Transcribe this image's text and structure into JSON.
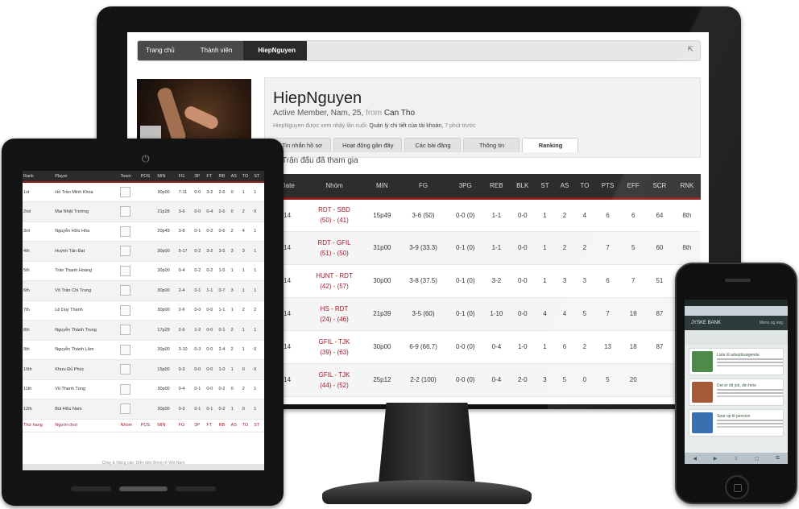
{
  "desktop": {
    "breadcrumb": [
      "Trang chủ",
      "Thành viên",
      "HiepNguyen"
    ],
    "profile": {
      "name": "HiepNguyen",
      "meta_prefix": "Active Member, Nam, 25,",
      "meta_from": "from",
      "location": "Can Tho",
      "desc_prefix": "HiepNguyen được xem nhậy lần cuối:",
      "desc_bold": "Quản lý chi tiết của tài khoản,",
      "desc_suffix": "7 phút trước",
      "tabs": [
        "Tin nhắn hồ sơ",
        "Hoạt động gần đây",
        "Các bài đăng",
        "Thông tin",
        "Ranking"
      ],
      "active_tab": "Ranking"
    },
    "section_title": "Trận đấu đã tham gia",
    "stats": {
      "columns": [
        "Date",
        "Nhóm",
        "MIN",
        "FG",
        "3PG",
        "REB",
        "BLK",
        "ST",
        "AS",
        "TO",
        "PTS",
        "EFF",
        "SCR",
        "RNK"
      ],
      "rows": [
        {
          "date": "02/14",
          "team": "RDT - SBD",
          "score": "(50) - (41)",
          "min": "15p49",
          "fg": "3-6 (50)",
          "p3": "0-0 (0)",
          "reb": "1-1",
          "blk": "0-0",
          "st": "1",
          "as": "2",
          "to": "4",
          "pts": "6",
          "eff": "6",
          "scr": "64",
          "rnk": "8th"
        },
        {
          "date": "02/14",
          "team": "RDT - GFIL",
          "score": "(51) - (50)",
          "min": "31p00",
          "fg": "3-9 (33.3)",
          "p3": "0-1 (0)",
          "reb": "1-1",
          "blk": "0-0",
          "st": "1",
          "as": "2",
          "to": "2",
          "pts": "7",
          "eff": "5",
          "scr": "60",
          "rnk": "8th"
        },
        {
          "date": "02/14",
          "team": "HUNT - RDT",
          "score": "(42) - (57)",
          "min": "30p00",
          "fg": "3-8 (37.5)",
          "p3": "0-1 (0)",
          "reb": "3-2",
          "blk": "0-0",
          "st": "1",
          "as": "3",
          "to": "3",
          "pts": "6",
          "eff": "7",
          "scr": "51",
          "rnk": ""
        },
        {
          "date": "02/14",
          "team": "HS - RDT",
          "score": "(24) - (46)",
          "min": "21p39",
          "fg": "3-5 (60)",
          "p3": "0-1 (0)",
          "reb": "1-10",
          "blk": "0-0",
          "st": "4",
          "as": "4",
          "to": "5",
          "pts": "7",
          "eff": "18",
          "scr": "87",
          "rnk": ""
        },
        {
          "date": "02/14",
          "team": "GFIL - TJK",
          "score": "(39) - (63)",
          "min": "30p00",
          "fg": "6-9 (66.7)",
          "p3": "0-0 (0)",
          "reb": "0-4",
          "blk": "1-0",
          "st": "1",
          "as": "6",
          "to": "2",
          "pts": "13",
          "eff": "18",
          "scr": "87",
          "rnk": ""
        },
        {
          "date": "02/14",
          "team": "GFIL - TJK",
          "score": "(44) - (52)",
          "min": "25p12",
          "fg": "2-2 (100)",
          "p3": "0-0 (0)",
          "reb": "0-4",
          "blk": "2-0",
          "st": "3",
          "as": "5",
          "to": "0",
          "pts": "5",
          "eff": "20",
          "scr": "",
          "rnk": ""
        }
      ]
    }
  },
  "tablet": {
    "columns": [
      "Rank",
      "Player",
      "Team",
      "POS",
      "MIN",
      "FG",
      "3P",
      "FT",
      "RB",
      "AS",
      "TO",
      "ST"
    ],
    "rows": [
      {
        "rank": "1st",
        "player": "Hồ Trần Minh Khoa",
        "min": "30p00",
        "fg": "7-11",
        "p3": "0-0",
        "ft": "3-2",
        "rb": "2-6",
        "as": "0",
        "to": "1",
        "st": "1"
      },
      {
        "rank": "2nd",
        "player": "Mai Nhật Trường",
        "min": "21p28",
        "fg": "3-6",
        "p3": "0-0",
        "ft": "0-4",
        "rb": "2-6",
        "as": "0",
        "to": "2",
        "st": "0"
      },
      {
        "rank": "3rd",
        "player": "Nguyễn Hữu Hòa",
        "min": "20p49",
        "fg": "3-8",
        "p3": "0-1",
        "ft": "0-2",
        "rb": "0-6",
        "as": "2",
        "to": "4",
        "st": "1"
      },
      {
        "rank": "4th",
        "player": "Huỳnh Tấn Đạt",
        "min": "30p00",
        "fg": "5-17",
        "p3": "0-2",
        "ft": "3-2",
        "rb": "3-5",
        "as": "3",
        "to": "3",
        "st": "1"
      },
      {
        "rank": "5th",
        "player": "Trần Thanh Hoàng",
        "min": "30p00",
        "fg": "0-4",
        "p3": "0-2",
        "ft": "0-2",
        "rb": "1-5",
        "as": "1",
        "to": "1",
        "st": "1"
      },
      {
        "rank": "6th",
        "player": "Võ Trần Chí Trung",
        "min": "30p00",
        "fg": "2-4",
        "p3": "0-1",
        "ft": "1-1",
        "rb": "0-7",
        "as": "3",
        "to": "1",
        "st": "1"
      },
      {
        "rank": "7th",
        "player": "Lê Duy Thanh",
        "min": "30p00",
        "fg": "2-6",
        "p3": "0-0",
        "ft": "0-0",
        "rb": "1-1",
        "as": "1",
        "to": "2",
        "st": "2"
      },
      {
        "rank": "8th",
        "player": "Nguyễn Thành Trung",
        "min": "17p29",
        "fg": "2-6",
        "p3": "1-2",
        "ft": "0-0",
        "rb": "0-1",
        "as": "2",
        "to": "1",
        "st": "1"
      },
      {
        "rank": "9th",
        "player": "Nguyễn Thành Lâm",
        "min": "30p00",
        "fg": "3-10",
        "p3": "0-3",
        "ft": "0-0",
        "rb": "2-4",
        "as": "2",
        "to": "1",
        "st": "0"
      },
      {
        "rank": "10th",
        "player": "Khưu Đủ Phúc",
        "min": "15p00",
        "fg": "0-3",
        "p3": "0-0",
        "ft": "0-0",
        "rb": "1-0",
        "as": "1",
        "to": "0",
        "st": "0"
      },
      {
        "rank": "11th",
        "player": "Vũ Thanh Tùng",
        "min": "30p00",
        "fg": "0-4",
        "p3": "0-1",
        "ft": "0-0",
        "rb": "0-2",
        "as": "0",
        "to": "2",
        "st": "1"
      },
      {
        "rank": "12th",
        "player": "Bùi Hữu Nam",
        "min": "30p00",
        "fg": "0-3",
        "p3": "0-1",
        "ft": "0-1",
        "rb": "0-2",
        "as": "1",
        "to": "0",
        "st": "1"
      }
    ],
    "footer_row": [
      "Thứ hạng",
      "Người chơi",
      "Nhóm",
      "POS",
      "MIN",
      "FG",
      "3P",
      "FT",
      "RB",
      "AS",
      "TO",
      "ST"
    ],
    "footer_text": "Chạy & Nâng cấp: Diễn đàn Bóng rổ Việt Nam"
  },
  "phone": {
    "bank_name": "JYSKE BANK",
    "menu_label": "Menu og søg",
    "cards": [
      {
        "title": "Liste til arbejdssøgende",
        "thumb_color": "#4f8a4a"
      },
      {
        "title": "Det er dit job, din ferie",
        "thumb_color": "#a55a3a"
      },
      {
        "title": "Spar op til pension",
        "thumb_color": "#3a6fb0"
      }
    ],
    "nav_icons": [
      "◀",
      "▶",
      "⇪",
      "▢",
      "⧉"
    ]
  }
}
